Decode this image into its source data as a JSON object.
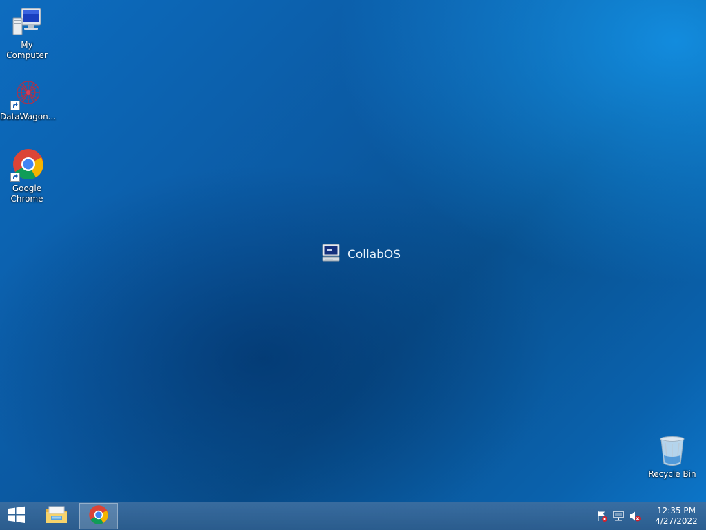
{
  "desktop": {
    "icons": [
      {
        "label": "My Computer",
        "icon": "computer-icon",
        "shortcut": false
      },
      {
        "label": "DataWagon...",
        "icon": "datawagon-icon",
        "shortcut": true
      },
      {
        "label": "Google\nChrome",
        "icon": "chrome-icon",
        "shortcut": true
      },
      {
        "label": "Recycle Bin",
        "icon": "recycle-bin-icon",
        "shortcut": false
      }
    ],
    "center_logo": {
      "text": "CollabOS",
      "icon": "collabos-computer-icon"
    }
  },
  "taskbar": {
    "start": {
      "icon": "windows-logo-icon"
    },
    "pinned": [
      {
        "icon": "file-explorer-icon",
        "active": false
      },
      {
        "icon": "chrome-icon",
        "active": true
      }
    ],
    "tray": {
      "icons": [
        "action-center-flag-icon",
        "network-icon",
        "volume-muted-icon"
      ],
      "time": "12:35 PM",
      "date": "4/27/2022"
    }
  },
  "colors": {
    "desktop_base": "#0b5aa3",
    "taskbar": "#3a6a9c",
    "text": "#ffffff"
  }
}
